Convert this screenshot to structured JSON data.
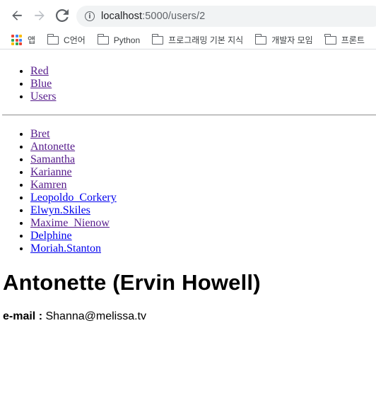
{
  "browser": {
    "url_host": "localhost",
    "url_path": ":5000/users/2",
    "bookmarks": [
      {
        "label": "앱",
        "icon": "apps-grid-icon"
      },
      {
        "label": "C언어",
        "icon": "folder-icon"
      },
      {
        "label": "Python",
        "icon": "folder-icon"
      },
      {
        "label": "프로그래밍 기본 지식",
        "icon": "folder-icon"
      },
      {
        "label": "개발자 모임",
        "icon": "folder-icon"
      },
      {
        "label": "프론트",
        "icon": "folder-icon"
      }
    ]
  },
  "menu": {
    "items": [
      "Red",
      "Blue",
      "Users"
    ]
  },
  "users": {
    "items": [
      "Bret",
      "Antonette",
      "Samantha",
      "Karianne",
      "Kamren",
      "Leopoldo_Corkery",
      "Elwyn.Skiles",
      "Maxime_Nienow",
      "Delphine",
      "Moriah.Stanton"
    ]
  },
  "detail": {
    "title": "Antonette (Ervin Howell)",
    "email_label": "e-mail :",
    "email_value": "Shanna@melissa.tv"
  },
  "colors": {
    "link": "#0000ee",
    "visited_link": "#551a8b"
  }
}
